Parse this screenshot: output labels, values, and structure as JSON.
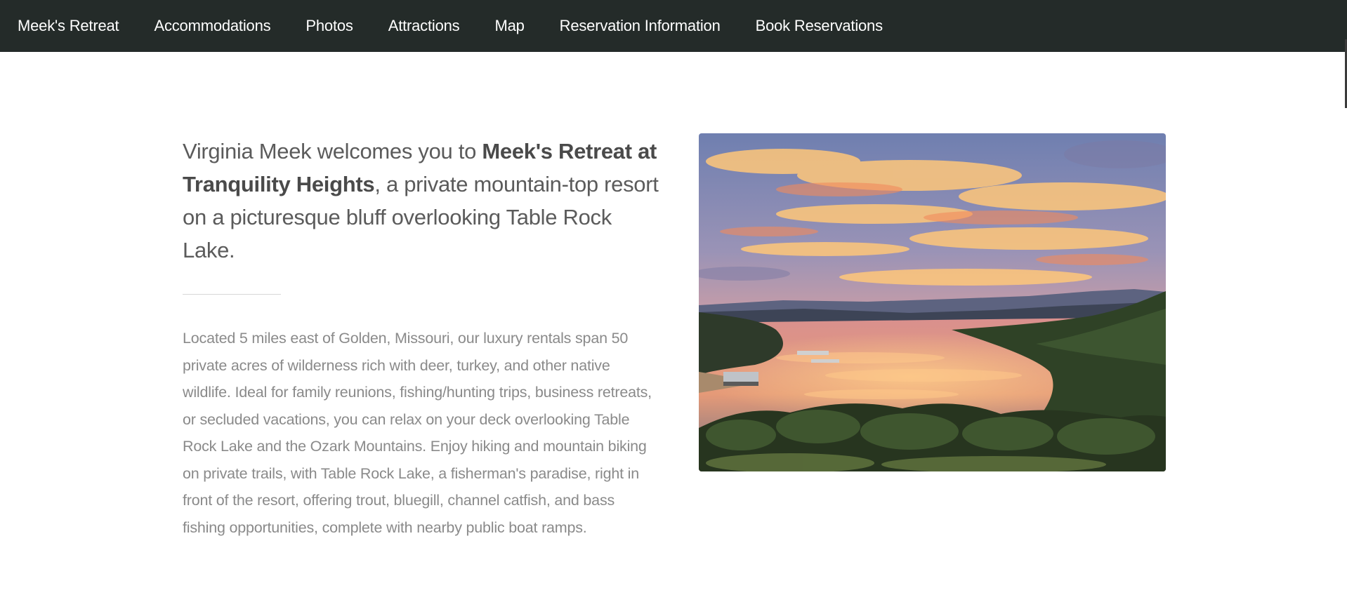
{
  "nav": {
    "items": [
      {
        "label": "Meek's Retreat"
      },
      {
        "label": "Accommodations"
      },
      {
        "label": "Photos"
      },
      {
        "label": "Attractions"
      },
      {
        "label": "Map"
      },
      {
        "label": "Reservation Information"
      },
      {
        "label": "Book Reservations"
      }
    ]
  },
  "intro": {
    "lead_prefix": "Virginia Meek welcomes you to ",
    "lead_strong": "Meek's Retreat at Tranquility Heights",
    "lead_suffix": ", a private mountain-top resort on a picturesque bluff overlooking Table Rock Lake.",
    "body": "Located 5 miles east of Golden, Missouri, our luxury rentals span 50 private acres of wilderness rich with deer, turkey, and other native wildlife. Ideal for family reunions, fishing/hunting trips, business retreats, or secluded vacations, you can relax on your deck overlooking Table Rock Lake and the Ozark Mountains. Enjoy hiking and mountain biking on private trails, with Table Rock Lake, a fisherman's paradise, right in front of the resort, offering trout, bluegill, channel catfish, and bass fishing opportunities, complete with nearby public boat ramps."
  },
  "photo": {
    "subject": "sunset over Table Rock Lake"
  },
  "colors": {
    "nav_bg": "#242b29",
    "nav_text": "#ffffff",
    "lead_text": "#5b5b5b",
    "body_text": "#8a8a8a"
  }
}
